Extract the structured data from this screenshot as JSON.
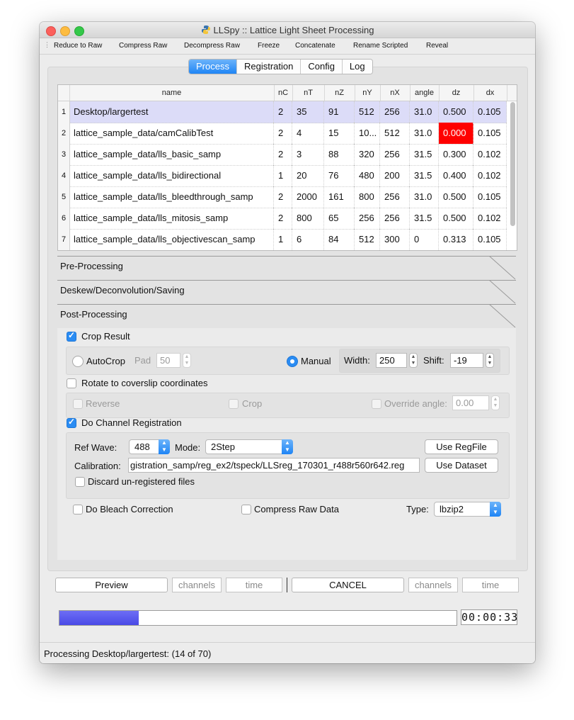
{
  "window": {
    "title": "LLSpy :: Lattice Light Sheet Processing"
  },
  "toolbar": {
    "items": [
      "Reduce to Raw",
      "Compress Raw",
      "Decompress Raw",
      "Freeze",
      "Concatenate",
      "Rename Scripted",
      "Reveal"
    ]
  },
  "tabs": [
    {
      "label": "Process",
      "active": true
    },
    {
      "label": "Registration",
      "active": false
    },
    {
      "label": "Config",
      "active": false
    },
    {
      "label": "Log",
      "active": false
    }
  ],
  "table": {
    "columns": [
      "name",
      "nC",
      "nT",
      "nZ",
      "nY",
      "nX",
      "angle",
      "dz",
      "dx"
    ],
    "rows": [
      {
        "num": "1",
        "cells": [
          "Desktop/largertest",
          "2",
          "35",
          "91",
          "512",
          "256",
          "31.0",
          "0.500",
          "0.105"
        ],
        "selected": true
      },
      {
        "num": "2",
        "cells": [
          "lattice_sample_data/camCalibTest",
          "2",
          "4",
          "15",
          "10...",
          "512",
          "31.0",
          "0.000",
          "0.105"
        ],
        "selected": false
      },
      {
        "num": "3",
        "cells": [
          "lattice_sample_data/lls_basic_samp",
          "2",
          "3",
          "88",
          "320",
          "256",
          "31.5",
          "0.300",
          "0.102"
        ],
        "selected": false
      },
      {
        "num": "4",
        "cells": [
          "lattice_sample_data/lls_bidirectional",
          "1",
          "20",
          "76",
          "480",
          "200",
          "31.5",
          "0.400",
          "0.102"
        ],
        "selected": false
      },
      {
        "num": "5",
        "cells": [
          "lattice_sample_data/lls_bleedthrough_samp",
          "2",
          "2000",
          "161",
          "800",
          "256",
          "31.0",
          "0.500",
          "0.105"
        ],
        "selected": false
      },
      {
        "num": "6",
        "cells": [
          "lattice_sample_data/lls_mitosis_samp",
          "2",
          "800",
          "65",
          "256",
          "256",
          "31.5",
          "0.500",
          "0.102"
        ],
        "selected": false
      },
      {
        "num": "7",
        "cells": [
          "lattice_sample_data/lls_objectivescan_samp",
          "1",
          "6",
          "84",
          "512",
          "300",
          "0",
          "0.313",
          "0.105"
        ],
        "selected": false
      }
    ]
  },
  "sections": {
    "pre": "Pre-Processing",
    "deskew": "Deskew/Deconvolution/Saving",
    "post": "Post-Processing"
  },
  "post": {
    "crop_result": {
      "label": "Crop Result",
      "checked": true
    },
    "autocrop": {
      "label": "AutoCrop",
      "pad_label": "Pad",
      "pad_value": "50"
    },
    "manual": {
      "label": "Manual",
      "width_label": "Width:",
      "width_value": "250",
      "shift_label": "Shift:",
      "shift_value": "-19"
    },
    "rotate": {
      "label": "Rotate to coverslip coordinates",
      "checked": false
    },
    "reverse": {
      "label": "Reverse"
    },
    "crop": {
      "label": "Crop"
    },
    "override_angle": {
      "label": "Override angle:",
      "value": "0.00"
    },
    "channel_reg": {
      "label": "Do Channel Registration",
      "checked": true
    },
    "ref_wave": {
      "label": "Ref Wave:",
      "value": "488"
    },
    "mode": {
      "label": "Mode:",
      "value": "2Step"
    },
    "use_regfile": "Use RegFile",
    "calibration": {
      "label": "Calibration:",
      "value": "gistration_samp/reg_ex2/tspeck/LLSreg_170301_r488r560r642.reg"
    },
    "use_dataset": "Use Dataset",
    "discard": {
      "label": "Discard un-registered files"
    },
    "bleach": {
      "label": "Do Bleach Correction"
    },
    "compress": {
      "label": "Compress Raw Data"
    },
    "type": {
      "label": "Type:",
      "value": "lbzip2"
    }
  },
  "controls": {
    "preview": "Preview",
    "channels": "channels",
    "time": "time",
    "cancel": "CANCEL"
  },
  "progress": {
    "fraction": 0.2,
    "timer": "00:00:33"
  },
  "status": "Processing Desktop/largertest: (14 of 70)",
  "colors": {
    "accent": "#1f85f5",
    "selected_row": "#dcdcf8",
    "error_cell": "#ff0000",
    "progress": "#4a4ae6"
  }
}
